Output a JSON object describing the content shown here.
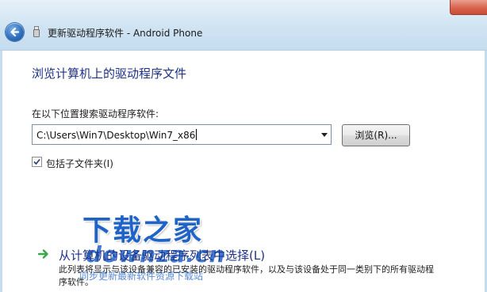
{
  "window": {
    "title": "更新驱动程序软件 - Android Phone"
  },
  "page": {
    "heading": "浏览计算机上的驱动程序文件",
    "search_label": "在以下位置搜索驱动程序软件:",
    "path_value": "C:\\Users\\Win7\\Desktop\\Win7_x86",
    "browse_label": "浏览(R)...",
    "include_subfolders_label": "包括子文件夹(I)",
    "include_subfolders_checked": true
  },
  "option": {
    "title": "从计算机的设备驱动程序列表中选择(L)",
    "description": "此列表将显示与该设备兼容的已安装的驱动程序软件，以及与该设备处于同一类别下的所有驱动程序软件。"
  },
  "watermark": {
    "logo": "下载之家",
    "url": "downza.cn",
    "subtitle": "同步更新最新软件资源下载站"
  },
  "colors": {
    "heading_blue": "#1e3287",
    "titlebar_blue": "#cfe3f2",
    "close_red": "#d8624c",
    "option_arrow_green": "#3aa648"
  },
  "icons": {
    "back": "back-arrow-icon",
    "device": "usb-device-icon",
    "option": "green-arrow-icon",
    "close": "close-icon"
  }
}
